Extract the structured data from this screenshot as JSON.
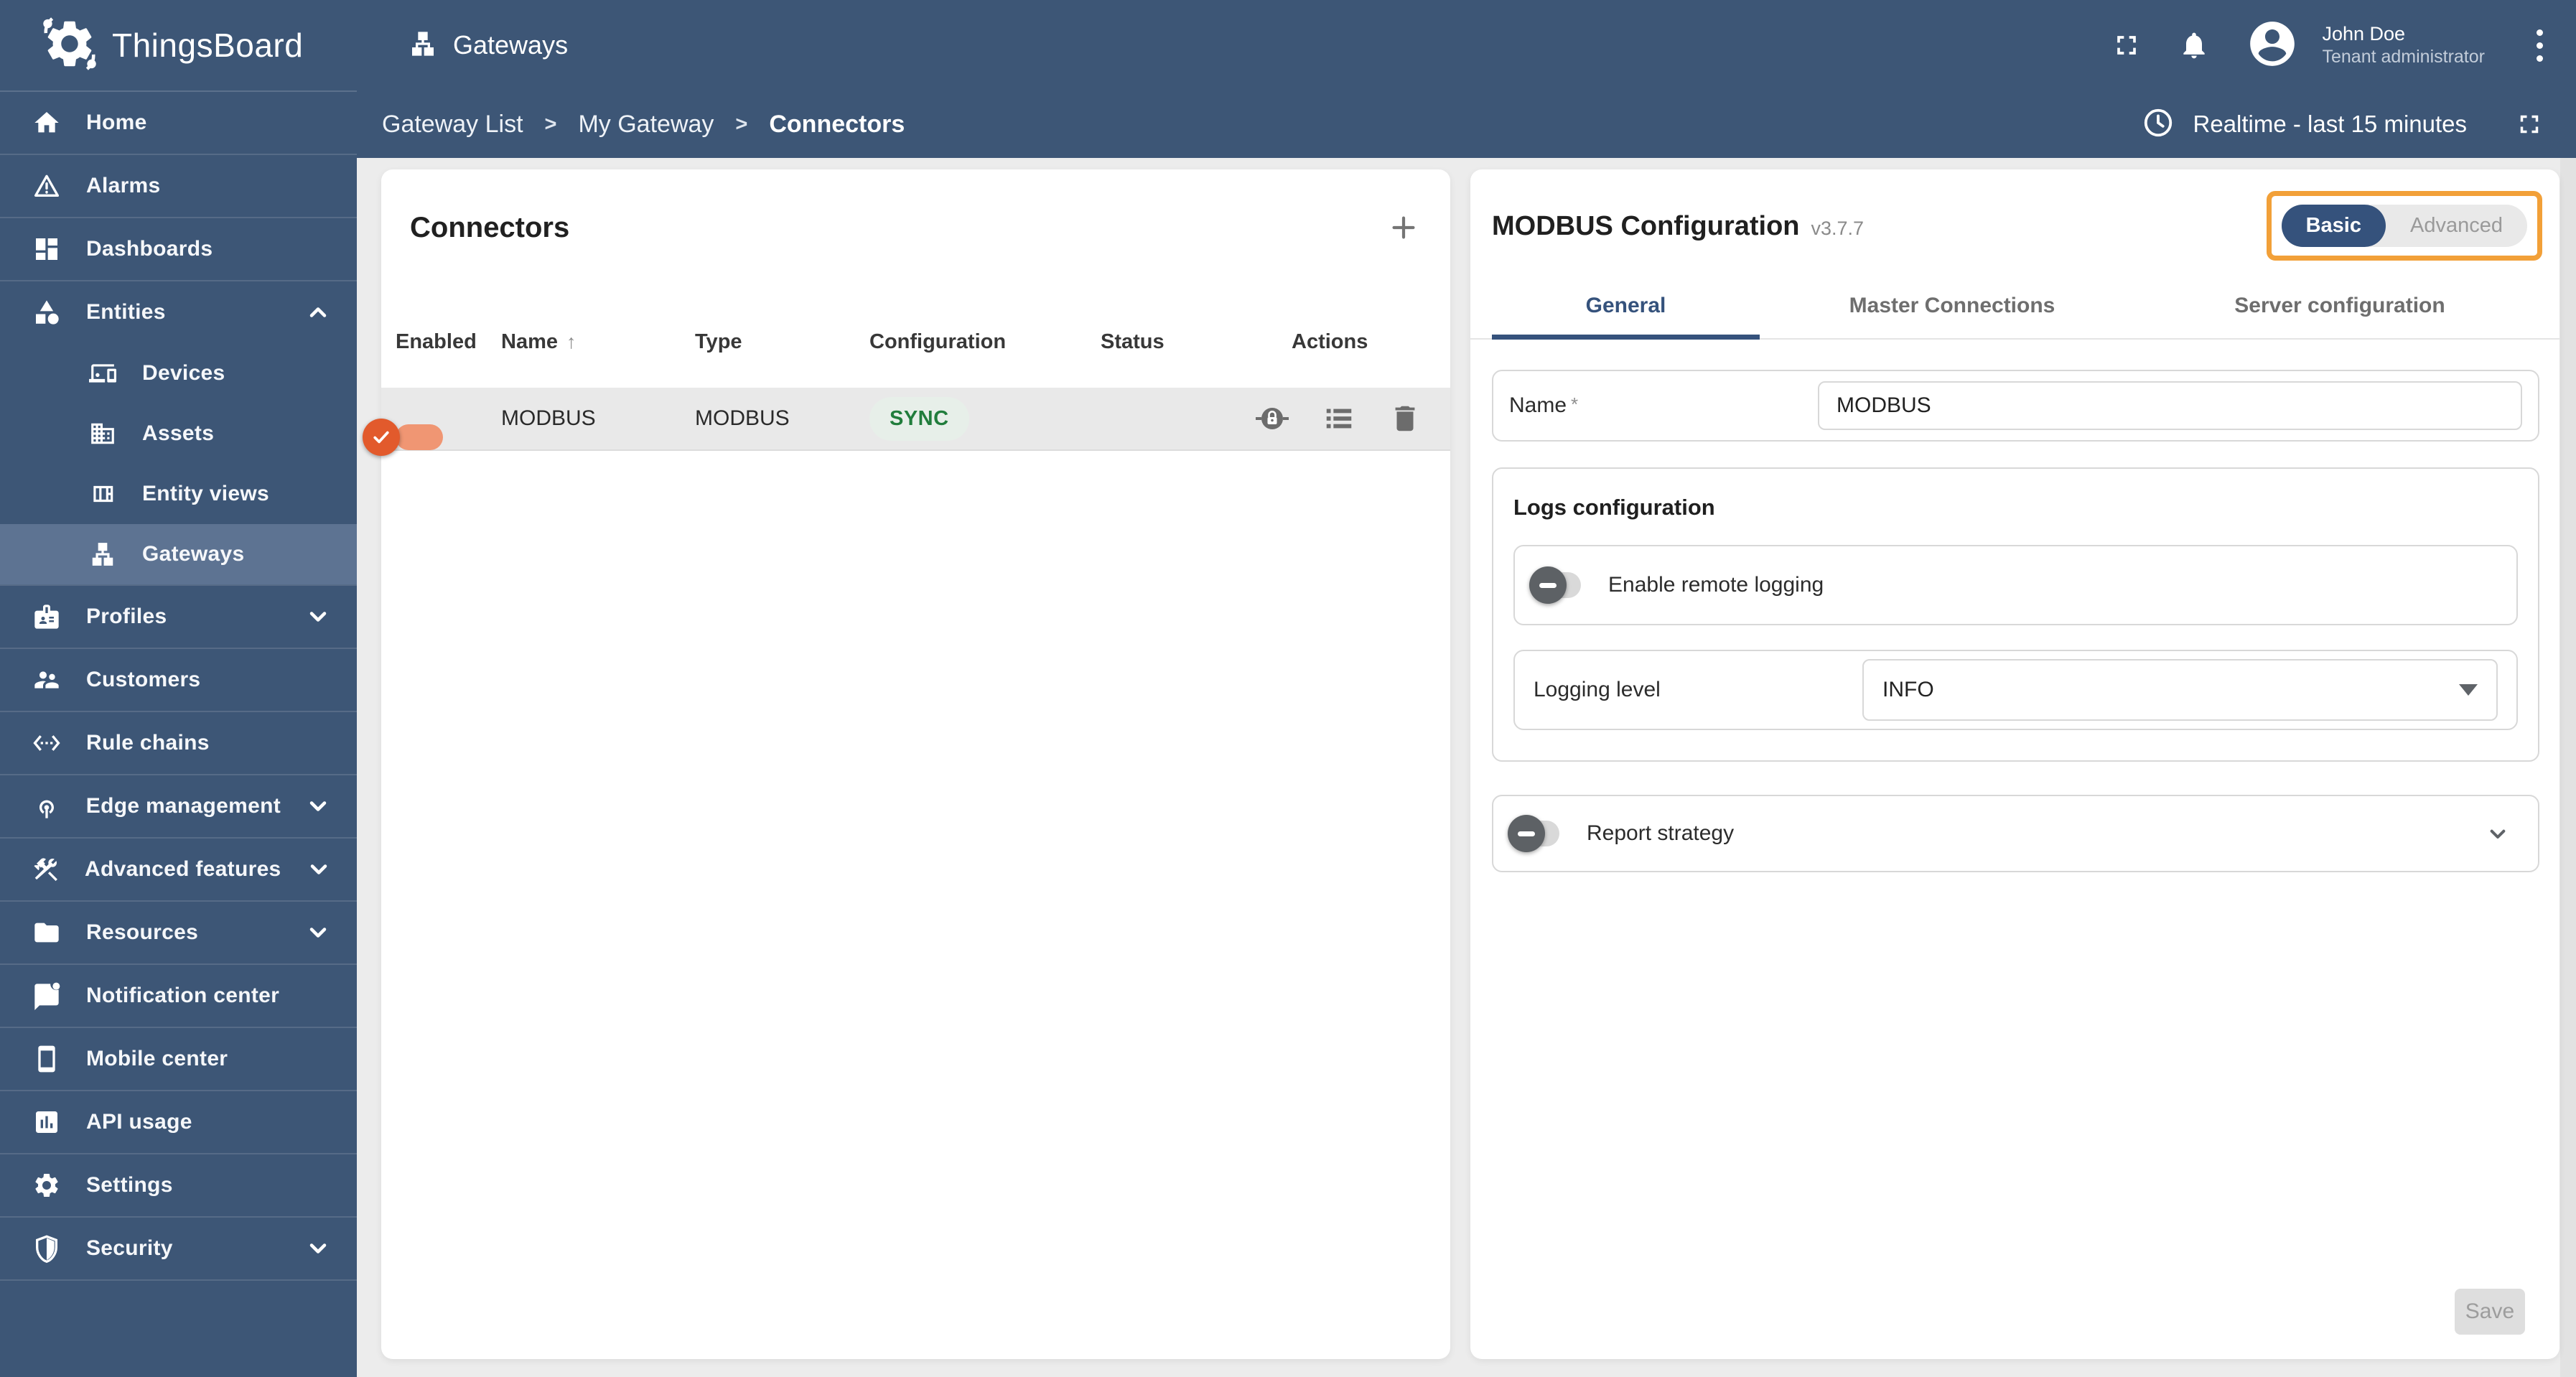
{
  "topbar": {
    "brand": "ThingsBoard",
    "page": {
      "title": "Gateways"
    },
    "user": {
      "name": "John Doe",
      "role": "Tenant administrator"
    }
  },
  "breadcrumb": {
    "separator": ">",
    "items": [
      {
        "label": "Gateway List"
      },
      {
        "label": "My Gateway"
      },
      {
        "label": "Connectors"
      }
    ]
  },
  "timewindow": {
    "label": "Realtime - last 15 minutes"
  },
  "sidebar": {
    "items": [
      {
        "label": "Home"
      },
      {
        "label": "Alarms"
      },
      {
        "label": "Dashboards"
      },
      {
        "label": "Entities",
        "expanded": true
      },
      {
        "label": "Devices"
      },
      {
        "label": "Assets"
      },
      {
        "label": "Entity views"
      },
      {
        "label": "Gateways",
        "selected": true
      },
      {
        "label": "Profiles"
      },
      {
        "label": "Customers"
      },
      {
        "label": "Rule chains"
      },
      {
        "label": "Edge management"
      },
      {
        "label": "Advanced features"
      },
      {
        "label": "Resources"
      },
      {
        "label": "Notification center"
      },
      {
        "label": "Mobile center"
      },
      {
        "label": "API usage"
      },
      {
        "label": "Settings"
      },
      {
        "label": "Security"
      }
    ]
  },
  "connectors": {
    "title": "Connectors",
    "columns": {
      "enabled": "Enabled",
      "name": "Name",
      "type": "Type",
      "configuration": "Configuration",
      "status": "Status",
      "actions": "Actions"
    },
    "rows": [
      {
        "enabled": true,
        "name": "MODBUS",
        "type": "MODBUS",
        "configuration": "SYNC",
        "status": "active"
      }
    ]
  },
  "config": {
    "title": "MODBUS Configuration",
    "version": "v3.7.7",
    "mode": {
      "basic": "Basic",
      "advanced": "Advanced",
      "selected": "Basic"
    },
    "tabs": [
      {
        "label": "General",
        "active": true
      },
      {
        "label": "Master Connections",
        "active": false
      },
      {
        "label": "Server configuration",
        "active": false
      }
    ],
    "name_field": {
      "label": "Name",
      "required_mark": "*",
      "value": "MODBUS"
    },
    "logs": {
      "heading": "Logs configuration",
      "remote_toggle_label": "Enable remote logging",
      "remote_enabled": false,
      "level_label": "Logging level",
      "level_value": "INFO"
    },
    "report_strategy": {
      "label": "Report strategy",
      "enabled": false
    },
    "save_label": "Save"
  },
  "colors": {
    "primary_blue": "#3d5676",
    "sidebar_selected": "#5d7392",
    "accent_dark_blue": "#35527c",
    "toggle_orange": "#e25a2c",
    "highlight_orange_border": "#f2a038",
    "success_green": "#2e7d32",
    "chip_green_bg": "#e7efe9",
    "content_bg": "#ececec"
  }
}
